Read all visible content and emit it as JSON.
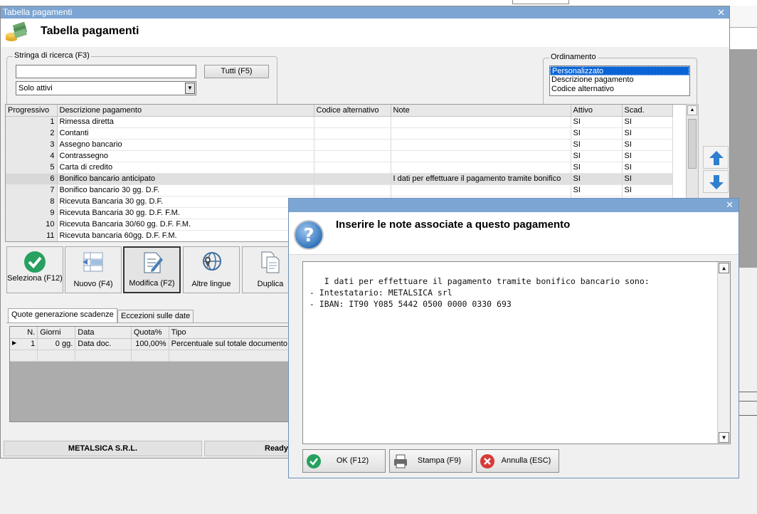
{
  "main_window": {
    "title": "Tabella pagamenti",
    "header_title": "Tabella pagamenti"
  },
  "search": {
    "legend": "Stringa di ricerca (F3)",
    "value": "",
    "button_label": "Tutti (F5)",
    "filter_selected": "Solo attivi"
  },
  "ordering": {
    "legend": "Ordinamento",
    "options": [
      "Personalizzato",
      "Descrizione pagamento",
      "Codice alternativo"
    ],
    "selected": "Personalizzato"
  },
  "payments_table": {
    "columns": [
      "Progressivo",
      "Descrizione pagamento",
      "Codice alternativo",
      "Note",
      "Attivo",
      "Scad."
    ],
    "rows": [
      {
        "n": "1",
        "desc": "Rimessa diretta",
        "code": "",
        "note": "",
        "active": "SI",
        "scad": "SI"
      },
      {
        "n": "2",
        "desc": "Contanti",
        "code": "",
        "note": "",
        "active": "SI",
        "scad": "SI"
      },
      {
        "n": "3",
        "desc": "Assegno bancario",
        "code": "",
        "note": "",
        "active": "SI",
        "scad": "SI"
      },
      {
        "n": "4",
        "desc": "Contrassegno",
        "code": "",
        "note": "",
        "active": "SI",
        "scad": "SI"
      },
      {
        "n": "5",
        "desc": "Carta di credito",
        "code": "",
        "note": "",
        "active": "SI",
        "scad": "SI"
      },
      {
        "n": "6",
        "desc": "Bonifico bancario anticipato",
        "code": "",
        "note": "I dati per effettuare il pagamento tramite bonifico",
        "active": "SI",
        "scad": "SI"
      },
      {
        "n": "7",
        "desc": "Bonifico bancario 30 gg. D.F.",
        "code": "",
        "note": "",
        "active": "SI",
        "scad": "SI"
      },
      {
        "n": "8",
        "desc": "Ricevuta Bancaria 30 gg. D.F.",
        "code": "",
        "note": "",
        "active": "",
        "scad": ""
      },
      {
        "n": "9",
        "desc": "Ricevuta Bancaria 30 gg. D.F. F.M.",
        "code": "",
        "note": "",
        "active": "",
        "scad": ""
      },
      {
        "n": "10",
        "desc": "Ricevuta Bancaria 30/60 gg. D.F. F.M.",
        "code": "",
        "note": "",
        "active": "",
        "scad": ""
      },
      {
        "n": "11",
        "desc": "Ricevuta bancaria 60gg. D.F. F.M.",
        "code": "",
        "note": "",
        "active": "",
        "scad": ""
      }
    ]
  },
  "toolbar": {
    "select_label": "Seleziona (F12)",
    "new_label": "Nuovo (F4)",
    "edit_label": "Modifica (F2)",
    "languages_label": "Altre lingue",
    "duplicate_label": "Duplica"
  },
  "tabs": [
    "Quote generazione scadenze",
    "Eccezioni sulle date"
  ],
  "quotes_table": {
    "columns": [
      "N.",
      "Giorni",
      "Data",
      "Quota%",
      "Tipo"
    ],
    "rows": [
      {
        "n": "1",
        "days": "0 gg.",
        "date": "Data doc.",
        "quota": "100,00%",
        "type": "Percentuale sul totale documento"
      }
    ]
  },
  "status": {
    "company": "METALSICA S.R.L.",
    "state": "Ready"
  },
  "dialog": {
    "prompt": "Inserire le note associate a questo pagamento",
    "notes_text": "I dati per effettuare il pagamento tramite bonifico bancario sono:\n - Intestatario: METALSICA srl\n - IBAN: IT90 Y085 5442 0500 0000 0330 693",
    "ok_label": "OK (F12)",
    "print_label": "Stampa (F9)",
    "cancel_label": "Annulla (ESC)"
  },
  "icons": {
    "app": "money-stack-icon",
    "dialog": "question-icon",
    "move_up": "arrow-up-icon",
    "move_down": "arrow-down-icon"
  },
  "colors": {
    "titlebar": "#7ca5d3",
    "selection": "#0a64d6",
    "ok_green": "#27a060",
    "cancel_red": "#d83a3a",
    "arrow_blue": "#2e7fd0"
  }
}
